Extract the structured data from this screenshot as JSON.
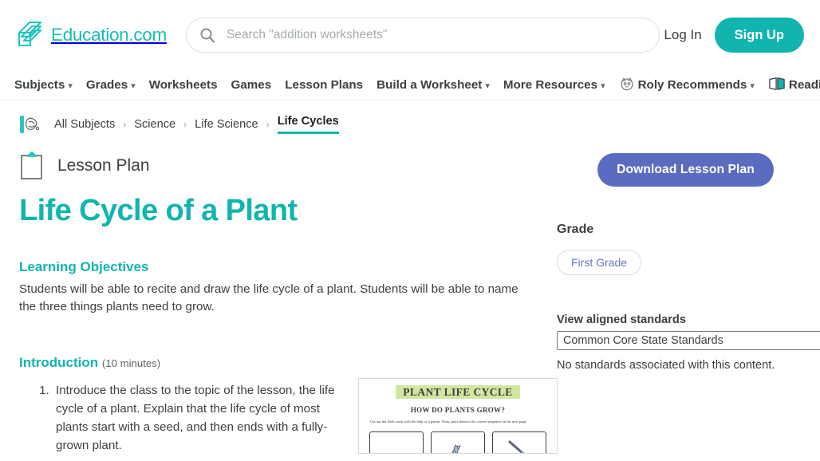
{
  "header": {
    "logo_text": "Education.com",
    "logo_icon": "education-book-logo-icon",
    "search": {
      "icon": "search-icon",
      "placeholder": "Search \"addition worksheets\"",
      "value": ""
    },
    "login_label": "Log In",
    "signup_label": "Sign Up",
    "accent_teal": "#12b5ad"
  },
  "nav": {
    "items": [
      {
        "label": "Subjects",
        "caret": true,
        "icon": null
      },
      {
        "label": "Grades",
        "caret": true,
        "icon": null
      },
      {
        "label": "Worksheets",
        "caret": false,
        "icon": null
      },
      {
        "label": "Games",
        "caret": false,
        "icon": null
      },
      {
        "label": "Lesson Plans",
        "caret": false,
        "icon": null
      },
      {
        "label": "Build a Worksheet",
        "caret": true,
        "icon": null
      },
      {
        "label": "More Resources",
        "caret": true,
        "icon": null
      },
      {
        "label": "Roly Recommends",
        "caret": true,
        "icon": "roly-mascot-icon"
      },
      {
        "label": "Reading M",
        "caret": false,
        "icon": "open-book-icon"
      }
    ]
  },
  "breadcrumb": {
    "icon": "science-subject-icon",
    "items": [
      {
        "label": "All Subjects",
        "active": false
      },
      {
        "label": "Science",
        "active": false
      },
      {
        "label": "Life Science",
        "active": false
      },
      {
        "label": "Life Cycles",
        "active": true
      }
    ],
    "separator": "›"
  },
  "content": {
    "page_type_icon": "clipboard-icon",
    "page_type_label": "Lesson Plan",
    "title": "Life Cycle of a Plant",
    "title_color": "#12b5ad",
    "sections": [
      {
        "heading": "Learning Objectives",
        "body": "Students will be able to recite and draw the life cycle of a plant. Students will be able to name the three things plants need to grow."
      }
    ],
    "introduction": {
      "heading": "Introduction",
      "duration": "(10 minutes)",
      "steps": [
        "Introduce the class to the topic of the lesson, the life cycle of a plant. Explain that the life cycle of most plants start with a seed, and then ends with a fully-grown plant."
      ]
    },
    "worksheet_thumbnail": {
      "name": "plant-life-cycle-worksheet-thumbnail",
      "title": "PLANT LIFE CYCLE",
      "subtitle": "HOW DO PLANTS GROW?",
      "instructions": "Cut out the flash cards with the help of a parent. Then, paste them in the correct sequence on the next page.",
      "highlight_color": "#cfe8a0"
    }
  },
  "sidebar": {
    "download_label": "Download Lesson Plan",
    "download_color": "#5b6bc0",
    "grade_label": "Grade",
    "grade_value": "First Grade",
    "standards_label": "View aligned standards",
    "standards_selected": "Common Core State Standards",
    "standards_options": [
      "Common Core State Standards"
    ],
    "standards_note": "No standards associated with this content."
  }
}
